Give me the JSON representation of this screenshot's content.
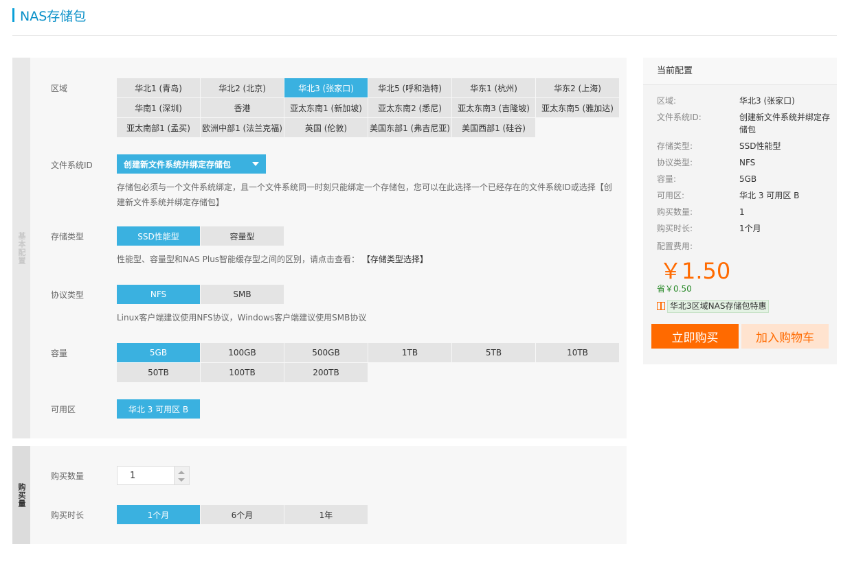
{
  "page_title": "NAS存储包",
  "basic": {
    "section_label": "基本配置",
    "region": {
      "label": "区域",
      "options": [
        "华北1 (青岛)",
        "华北2 (北京)",
        "华北3 (张家口)",
        "华北5 (呼和浩特)",
        "华东1 (杭州)",
        "华东2 (上海)",
        "华南1 (深圳)",
        "香港",
        "亚太东南1 (新加坡)",
        "亚太东南2 (悉尼)",
        "亚太东南3 (吉隆坡)",
        "亚太东南5 (雅加达)",
        "亚太南部1 (孟买)",
        "欧洲中部1 (法兰克福)",
        "英国 (伦敦)",
        "美国东部1 (弗吉尼亚)",
        "美国西部1 (硅谷)"
      ],
      "selected": "华北3 (张家口)"
    },
    "fs": {
      "label": "文件系统ID",
      "value": "创建新文件系统并绑定存储包",
      "desc": "存储包必须与一个文件系统绑定，且一个文件系统同一时刻只能绑定一个存储包，您可以在此选择一个已经存在的文件系统ID或选择【创建新文件系统并绑定存储包】"
    },
    "storage": {
      "label": "存储类型",
      "options": [
        "SSD性能型",
        "容量型"
      ],
      "selected": "SSD性能型",
      "desc": "性能型、容量型和NAS Plus智能缓存型之间的区别，请点击查看：",
      "link": "【存储类型选择】"
    },
    "protocol": {
      "label": "协议类型",
      "options": [
        "NFS",
        "SMB"
      ],
      "selected": "NFS",
      "desc": "Linux客户端建议使用NFS协议，Windows客户端建议使用SMB协议"
    },
    "capacity": {
      "label": "容量",
      "options": [
        "5GB",
        "100GB",
        "500GB",
        "1TB",
        "5TB",
        "10TB",
        "50TB",
        "100TB",
        "200TB"
      ],
      "selected": "5GB"
    },
    "zone": {
      "label": "可用区",
      "options": [
        "华北 3 可用区 B"
      ],
      "selected": "华北 3 可用区 B"
    }
  },
  "buy": {
    "section_label": "购买量",
    "qty": {
      "label": "购买数量",
      "value": "1"
    },
    "duration": {
      "label": "购买时长",
      "options": [
        "1个月",
        "6个月",
        "1年"
      ],
      "selected": "1个月"
    }
  },
  "summary": {
    "title": "当前配置",
    "rows": [
      {
        "k": "区域:",
        "v": "华北3 (张家口)"
      },
      {
        "k": "文件系统ID:",
        "v": "创建新文件系统并绑定存储包"
      },
      {
        "k": "存储类型:",
        "v": "SSD性能型"
      },
      {
        "k": "协议类型:",
        "v": "NFS"
      },
      {
        "k": "容量:",
        "v": "5GB"
      },
      {
        "k": "可用区:",
        "v": "华北 3 可用区 B"
      },
      {
        "k": "购买数量:",
        "v": "1"
      },
      {
        "k": "购买时长:",
        "v": "1个月"
      }
    ],
    "fee_label": "配置费用:",
    "price": "￥1.50",
    "save": "省￥0.50",
    "promo": "华北3区域NAS存储包特惠",
    "buy_button": "立即购买",
    "cart_button": "加入购物车"
  },
  "colors": {
    "accent": "#3ab1e0",
    "title": "#0a90c8",
    "buy": "#ff6a00",
    "cart_bg": "#ffe3cf"
  }
}
